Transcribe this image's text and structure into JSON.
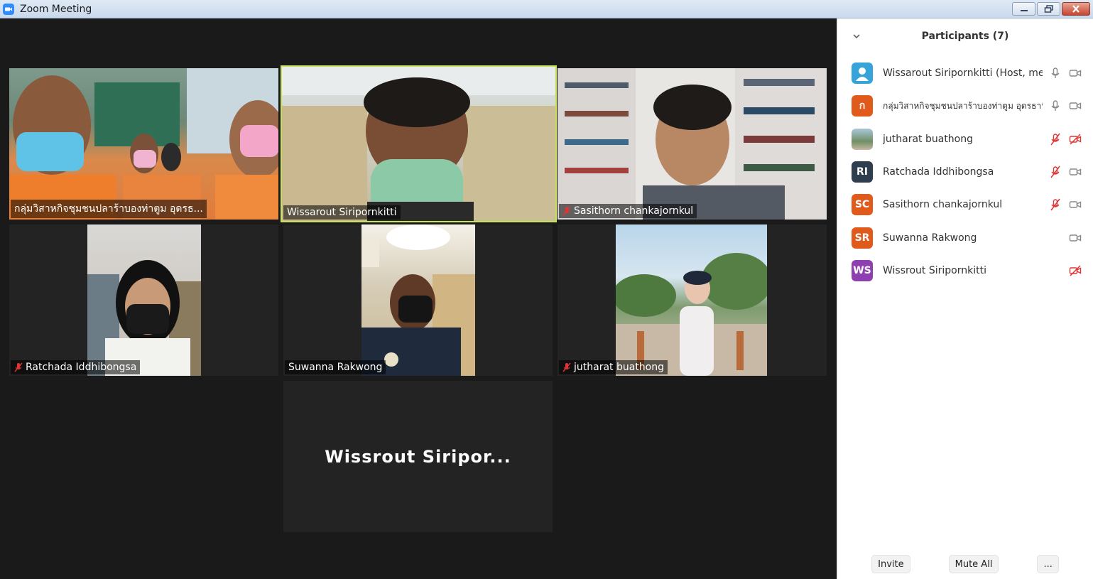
{
  "window": {
    "title": "Zoom Meeting"
  },
  "tiles": [
    {
      "name": "กลุ่มวิสาหกิจชุมชนปลาร้าบองท่าตูม อุดรธ...",
      "muted": false
    },
    {
      "name": "Wissarout Siripornkitti",
      "muted": false
    },
    {
      "name": "Sasithorn chankajornkul",
      "muted": true
    },
    {
      "name": "Ratchada Iddhibongsa",
      "muted": true
    },
    {
      "name": "Suwanna Rakwong",
      "muted": false
    },
    {
      "name": "jutharat buathong",
      "muted": true
    },
    {
      "name": "Wissrout  Siripor..."
    }
  ],
  "participants": {
    "title": "Participants (7)",
    "list": [
      {
        "initials": "",
        "avatar": "person-icon",
        "color": "#36a3d9",
        "name": "Wissarout Siripornkitti (Host, me)",
        "mic": "on",
        "video": "on"
      },
      {
        "initials": "ก",
        "color": "#e05a1b",
        "name": "กลุ่มวิสาหกิจชุมชนปลาร้าบองท่าตูม อุดรธานี",
        "mic": "on",
        "video": "on"
      },
      {
        "initials": "",
        "avatar": "photo",
        "color": "#7aa3a0",
        "name": "jutharat buathong",
        "mic": "muted",
        "video": "off"
      },
      {
        "initials": "RI",
        "color": "#2f3e4e",
        "name": "Ratchada Iddhibongsa",
        "mic": "muted",
        "video": "on"
      },
      {
        "initials": "SC",
        "color": "#e05a1b",
        "name": "Sasithorn chankajornkul",
        "mic": "muted",
        "video": "on"
      },
      {
        "initials": "SR",
        "color": "#e05a1b",
        "name": "Suwanna Rakwong",
        "mic": "none",
        "video": "on"
      },
      {
        "initials": "WS",
        "color": "#8e3fb0",
        "name": "Wissrout Siripornkitti",
        "mic": "none",
        "video": "off"
      }
    ],
    "footer": {
      "invite": "Invite",
      "mute_all": "Mute All",
      "more": "..."
    }
  }
}
